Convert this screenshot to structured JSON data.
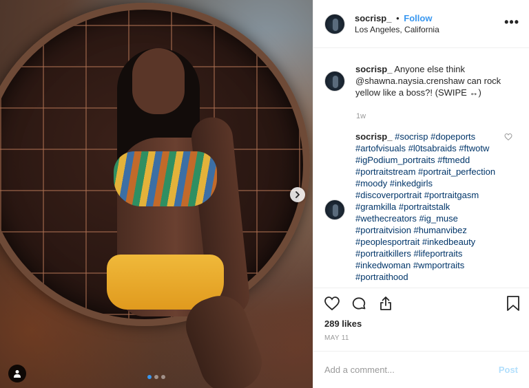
{
  "header": {
    "username": "socrisp_",
    "separator": "•",
    "follow_label": "Follow",
    "location": "Los Angeles, California",
    "more_icon": "more-options-icon",
    "more_label": "•••"
  },
  "caption": {
    "username": "socrisp_",
    "text": " Anyone else think @shawna.naysia.crenshaw can rock yellow like a boss?! (SWIPE ↔)",
    "time": "1w"
  },
  "comment": {
    "username": "socrisp_",
    "text": " #socrisp #dopeports #artofvisuals #l0tsabraids #ftwotw #igPodium_portraits #ftmedd #portraitstream #portrait_perfection #moody #inkedgirls #discoverportrait #portraitgasm #gramkilla #portraitstalk #wethecreators #ig_muse #portraitvision #humanvibez #peoplesportrait #inkedbeauty #portraitkillers #lifeportraits #inkedwoman #wmportraits #portraithood"
  },
  "actions": {
    "like_icon": "heart-icon",
    "comment_icon": "comment-icon",
    "share_icon": "share-icon",
    "save_icon": "bookmark-icon"
  },
  "likes": "289 likes",
  "date": "MAY 11",
  "add_comment": {
    "placeholder": "Add a comment...",
    "post_label": "Post"
  },
  "carousel": {
    "slides": 3,
    "active_index": 0
  },
  "colors": {
    "accent": "#3897f0",
    "hashtag": "#003569",
    "muted": "#999999",
    "post_disabled": "#b2dffc"
  }
}
